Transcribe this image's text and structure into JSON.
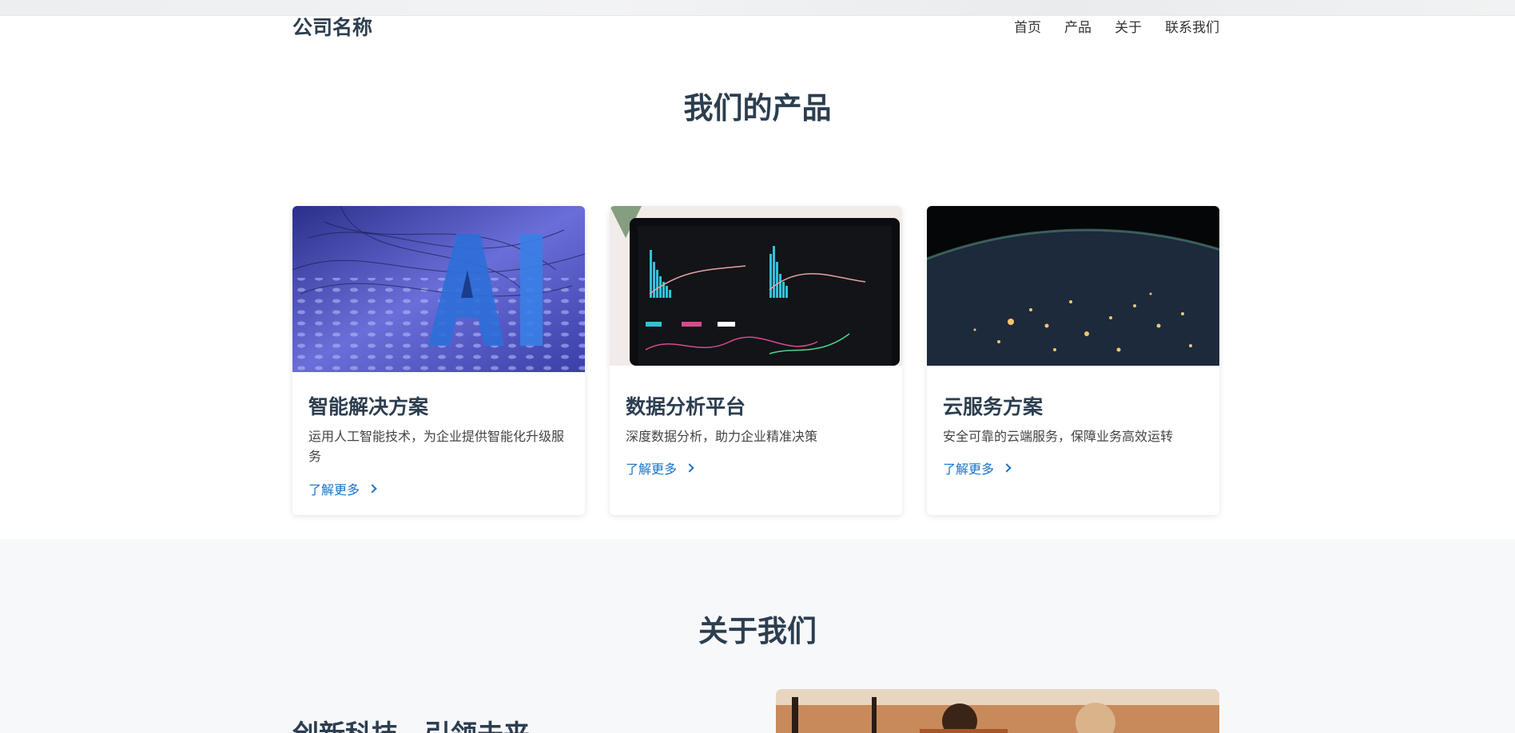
{
  "header": {
    "logo": "公司名称",
    "nav": [
      "首页",
      "产品",
      "关于",
      "联系我们"
    ]
  },
  "products": {
    "title": "我们的产品",
    "cards": [
      {
        "title": "智能解决方案",
        "desc": "运用人工智能技术，为企业提供智能化升级服务",
        "link": "了解更多",
        "image": "ai-letters-image"
      },
      {
        "title": "数据分析平台",
        "desc": "深度数据分析，助力企业精准决策",
        "link": "了解更多",
        "image": "analytics-dashboard-image"
      },
      {
        "title": "云服务方案",
        "desc": "安全可靠的云端服务，保障业务高效运转",
        "link": "了解更多",
        "image": "earth-night-image"
      }
    ]
  },
  "about": {
    "title": "关于我们",
    "subtitle": "创新科技，引领未来",
    "image": "team-meeting-image"
  },
  "colors": {
    "accent": "#1a73c8",
    "heading": "#2c3e50",
    "section_bg": "#f7f8fa"
  }
}
